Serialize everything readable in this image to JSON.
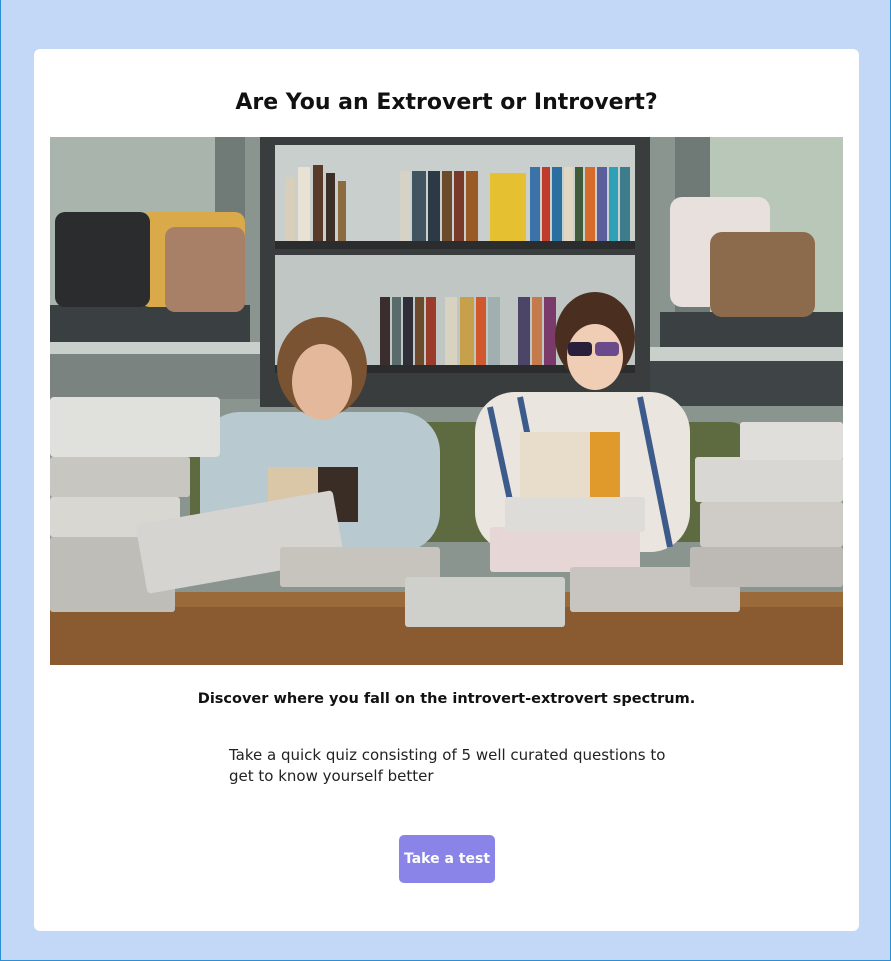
{
  "page": {
    "title": "Are You an Extrovert or Introvert?",
    "subtitle": "Discover where you fall on the introvert-extrovert spectrum.",
    "description": "Take a quick quiz consisting of 5 well curated questions to get to know yourself better",
    "cta_label": "Take a test",
    "hero_image_alt": "hero-photo"
  },
  "colors": {
    "background": "#c2d8f6",
    "card": "#ffffff",
    "button": "#8a84e8",
    "button_text": "#ffffff"
  }
}
